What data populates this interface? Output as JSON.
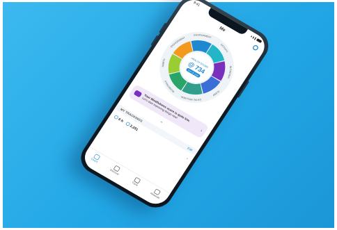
{
  "colors": {
    "background": "#29adea",
    "frame": "#0d1a24",
    "accent": "#1e88d0",
    "purple": "#7b2fbf",
    "mindfulness_tint": "#f0e8f8"
  },
  "status_bar": {
    "time": "9:41"
  },
  "header": {
    "title": "Me",
    "settings_icon": "gear-icon"
  },
  "wheel": {
    "score_label": "HEALTH SCORE",
    "score_value": "@ 734",
    "badge": "OUT OF 1000",
    "segments": [
      {
        "label": "ACTIVITY",
        "color": "#22b6c8"
      },
      {
        "label": "NUTRITION",
        "color": "#7b2fbf"
      },
      {
        "label": "SLEEP",
        "color": "#3a6fd8"
      },
      {
        "label": "MENTAL WELLBEING",
        "color": "#2f9e8a"
      },
      {
        "label": "BIOMETRICS",
        "color": "#2aa56a"
      },
      {
        "label": "HABITS",
        "color": "#9acd32"
      },
      {
        "label": "ENGAGEMENT",
        "color": "#f39a1e"
      },
      {
        "label": "ENVIRONMENT",
        "color": "#1e88d0"
      }
    ]
  },
  "message": {
    "title": "Your Mindfulness score is quite low.",
    "body": "Let's start improving things now!",
    "arrow": "›"
  },
  "collapse_icon": "chevron-up-icon",
  "trackings": {
    "title": "MY TRACKINGS",
    "edit_label": "Edit",
    "items": [
      {
        "value": "6 h",
        "icon": "sleep-icon"
      },
      {
        "value": "2,331",
        "icon": "steps-icon"
      }
    ]
  },
  "bottom_nav": [
    {
      "label": "Coach",
      "icon": "coach-icon",
      "active": true
    },
    {
      "label": "Discover",
      "icon": "discover-icon",
      "active": false
    },
    {
      "label": "Track",
      "icon": "track-icon",
      "active": false
    },
    {
      "label": "Rewards",
      "icon": "rewards-icon",
      "active": false
    }
  ]
}
